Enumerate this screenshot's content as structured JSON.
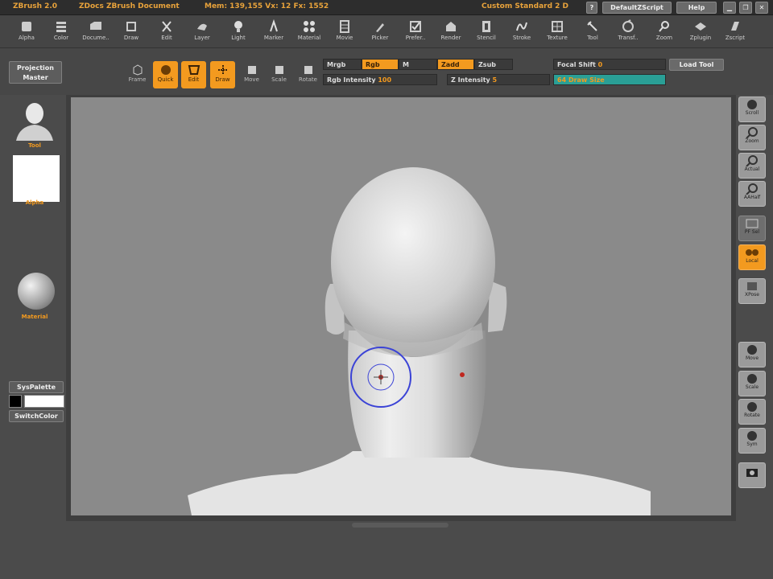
{
  "titlebar": {
    "app": "ZBrush 2.0",
    "doc": "ZDocs ZBrush Document",
    "stats": "Mem: 139,155  Vx: 12  Fx: 1552",
    "ui_layout": "Custom Standard 2 D",
    "help_q": "?",
    "default_script": "DefaultZScript",
    "help": "Help"
  },
  "menu": [
    "Alpha",
    "Color",
    "Docume..",
    "Draw",
    "Edit",
    "Layer",
    "Light",
    "Marker",
    "Material",
    "Movie",
    "Picker",
    "Prefer..",
    "Render",
    "Stencil",
    "Stroke",
    "Texture",
    "Tool",
    "Transf..",
    "Zoom",
    "Zplugin",
    "Zscript"
  ],
  "shelf": {
    "projection_master": "Projection Master",
    "frame": "Frame",
    "quick": "Quick",
    "edit": "Edit",
    "draw": "Draw",
    "move": "Move",
    "scale": "Scale",
    "rotate": "Rotate",
    "mrgb": "Mrgb",
    "rgb": "Rgb",
    "m": "M",
    "zadd": "Zadd",
    "zsub": "Zsub",
    "rgb_intensity_label": "Rgb Intensity",
    "rgb_intensity_value": "100",
    "z_intensity_label": "Z Intensity",
    "z_intensity_value": "5",
    "focal_shift_label": "Focal Shift",
    "focal_shift_value": "0",
    "draw_size_label": "Draw Size",
    "draw_size_value": "64",
    "load_tool": "Load Tool"
  },
  "left": {
    "tool_label": "Tool",
    "alpha_label": "Alpha",
    "material_label": "Material",
    "syspalette": "SysPalette",
    "switchcolor": "SwitchColor"
  },
  "right": [
    "Scroll",
    "Zoom",
    "Actual",
    "AAHalf",
    "PF Sel",
    "Local",
    "XPose",
    "Move",
    "Scale",
    "Rotate",
    "Sym",
    ""
  ],
  "colors": {
    "accent": "#f39a1f",
    "canvas": "#8a8a8a"
  }
}
